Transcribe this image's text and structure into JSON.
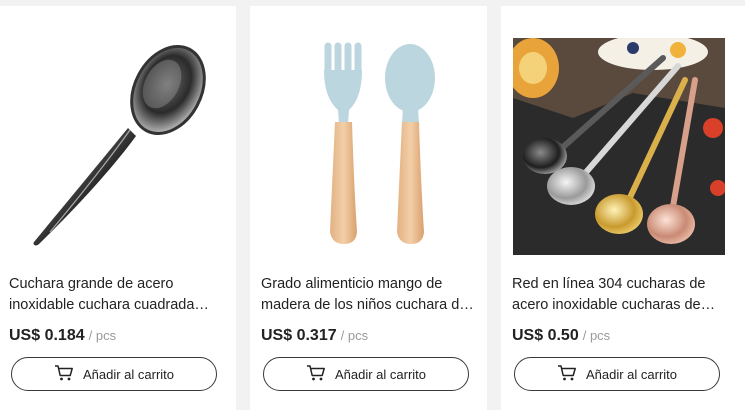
{
  "products": [
    {
      "title": "Cuchara grande de acero inoxidable cuchara cuadrada para servir arroz",
      "price": "US$ 0.184",
      "unit": "/ pcs",
      "button_label": "Añadir al carrito"
    },
    {
      "title": "Grado alimenticio mango de madera de los niños cuchara de silicona",
      "price": "US$ 0.317",
      "unit": "/ pcs",
      "button_label": "Añadir al carrito"
    },
    {
      "title": "Red en línea 304 cucharas de acero inoxidable cucharas de postre",
      "price": "US$ 0.50",
      "unit": "/ pcs",
      "button_label": "Añadir al carrito"
    }
  ],
  "icons": {
    "cart": "cart-icon"
  },
  "colors": {
    "background": "#f2f2f2",
    "card": "#ffffff",
    "border": "#3a3a3a"
  }
}
